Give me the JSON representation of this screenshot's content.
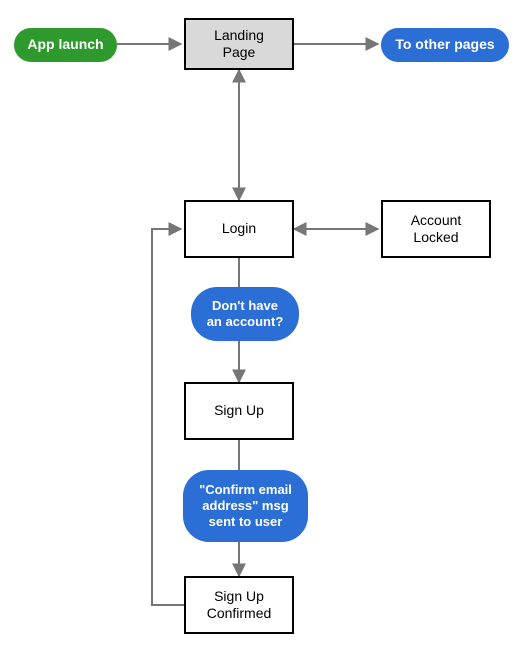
{
  "nodes": {
    "app_launch": {
      "label": "App launch"
    },
    "landing_page": {
      "label": "Landing\nPage"
    },
    "to_other_pages": {
      "label": "To other pages"
    },
    "login": {
      "label": "Login"
    },
    "account_locked": {
      "label": "Account\nLocked"
    },
    "sign_up": {
      "label": "Sign Up"
    },
    "sign_up_confirmed": {
      "label": "Sign Up\nConfirmed"
    }
  },
  "edges": {
    "app_launch_to_landing": {
      "from": "app_launch",
      "to": "landing_page",
      "bidirectional": false
    },
    "landing_to_other": {
      "from": "landing_page",
      "to": "to_other_pages",
      "bidirectional": false
    },
    "landing_to_login": {
      "from": "landing_page",
      "to": "login",
      "bidirectional": true
    },
    "login_to_account_locked": {
      "from": "login",
      "to": "account_locked",
      "bidirectional": true
    },
    "login_to_sign_up": {
      "from": "login",
      "to": "sign_up",
      "bidirectional": false,
      "annotation": "Don't have an account?"
    },
    "sign_up_to_confirmed": {
      "from": "sign_up",
      "to": "sign_up_confirmed",
      "bidirectional": false,
      "annotation": "\"Confirm email address\" msg sent to user"
    },
    "confirmed_back_to_login": {
      "from": "sign_up_confirmed",
      "to": "login",
      "bidirectional": false
    }
  },
  "annotations": {
    "no_account": {
      "text": "Don't have\nan account?"
    },
    "confirm_email": {
      "text": "\"Confirm email\naddress\" msg\nsent to user"
    }
  },
  "colors": {
    "green": "#2e9a2e",
    "blue": "#2a6ed6",
    "grey": "#d9d9d9",
    "arrow": "#767676"
  }
}
